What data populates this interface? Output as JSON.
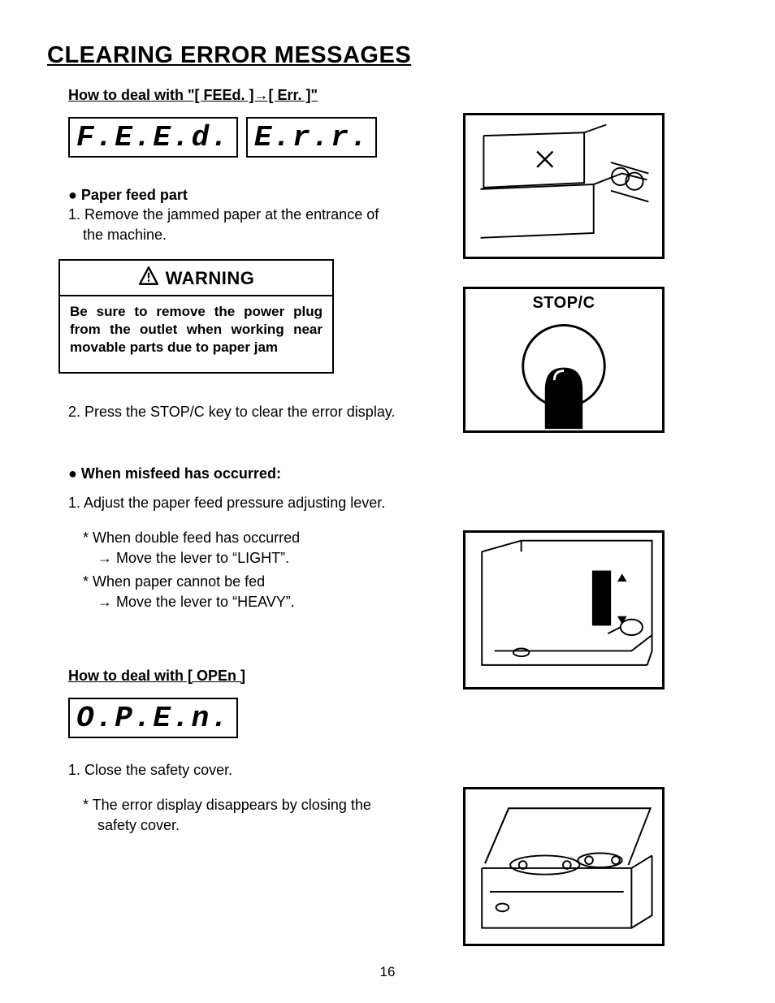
{
  "title": "CLEARING ERROR MESSAGES",
  "section_feed": {
    "heading": "How to deal with \"[ FEEd. ]→[ Err. ]\"",
    "lcd": [
      "F.E.E.d.",
      "E.r.r."
    ],
    "paper_feed": {
      "label": "● Paper feed part",
      "step1_a": "1. Remove the jammed paper at the entrance of",
      "step1_b": "the machine."
    },
    "warning": {
      "label": "WARNING",
      "body": "Be sure to remove the power plug from the outlet when working near movable parts due to paper jam"
    },
    "step2": "2. Press the STOP/C key to clear the error display.",
    "misfeed": {
      "label": "● When misfeed has occurred:",
      "step1": "1. Adjust the paper feed pressure adjusting lever.",
      "case1_a": "* When double feed has occurred",
      "case1_b": "→ Move the lever to “LIGHT”.",
      "case2_a": "* When paper cannot be fed",
      "case2_b": "→ Move the lever to “HEAVY”."
    }
  },
  "section_open": {
    "heading": "How to deal with [ OPEn ]",
    "lcd": "O.P.E.n.",
    "step1": "1. Close the safety cover.",
    "note_a": "* The error display disappears by closing the",
    "note_b": "safety cover."
  },
  "illustrations": {
    "fig1": "paper-feed-entrance",
    "fig2_label": "STOP/C",
    "fig3": "feed-pressure-lever",
    "fig4": "safety-cover-open"
  },
  "page_number": "16"
}
